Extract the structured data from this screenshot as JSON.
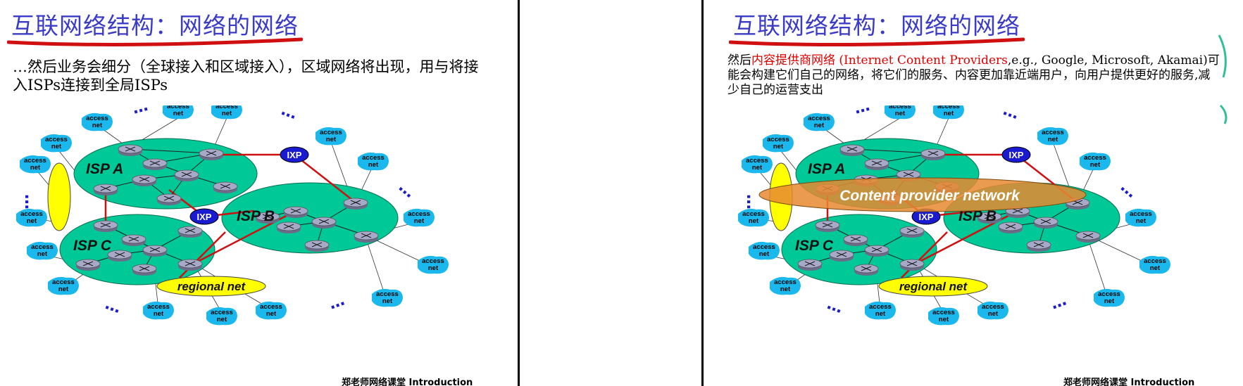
{
  "slides": [
    {
      "title": "互联网络结构：网络的网络",
      "body": "…然后业务会细分（全球接入和区域接入），区域网络将出现，用与将接入ISPs连接到全局ISPs",
      "footer": "郑老师网络课堂 Introduction"
    },
    {
      "title": "互联网络结构：网络的网络",
      "body_prefix": "然后",
      "body_highlight_cn": "内容提供商网络",
      "body_highlight_en": "(Internet Content Providers",
      "body_rest": ",e.g., Google, Microsoft, Akamai)可能会构建它们自己的网络，将它们的服务、内容更加靠近端用户，向用户提供更好的服务,减少自己的运营支出",
      "footer": "郑老师网络课堂 Introduction"
    }
  ],
  "diagram": {
    "isp_a": "ISP A",
    "isp_b": "ISP B",
    "isp_c": "ISP C",
    "ixp": "IXP",
    "regional": "regional net",
    "access_l1": "access",
    "access_l2": "net",
    "ellipsis": "…",
    "content_provider": "Content provider network"
  },
  "colors": {
    "title": "#3b3bc9",
    "isp_fill": "#00c896",
    "access_fill": "#1ab8ec",
    "ixp_fill": "#1a1ad0",
    "link_red": "#d01010",
    "regional_fill": "#ffff00",
    "content_fill": "#e88a30"
  }
}
